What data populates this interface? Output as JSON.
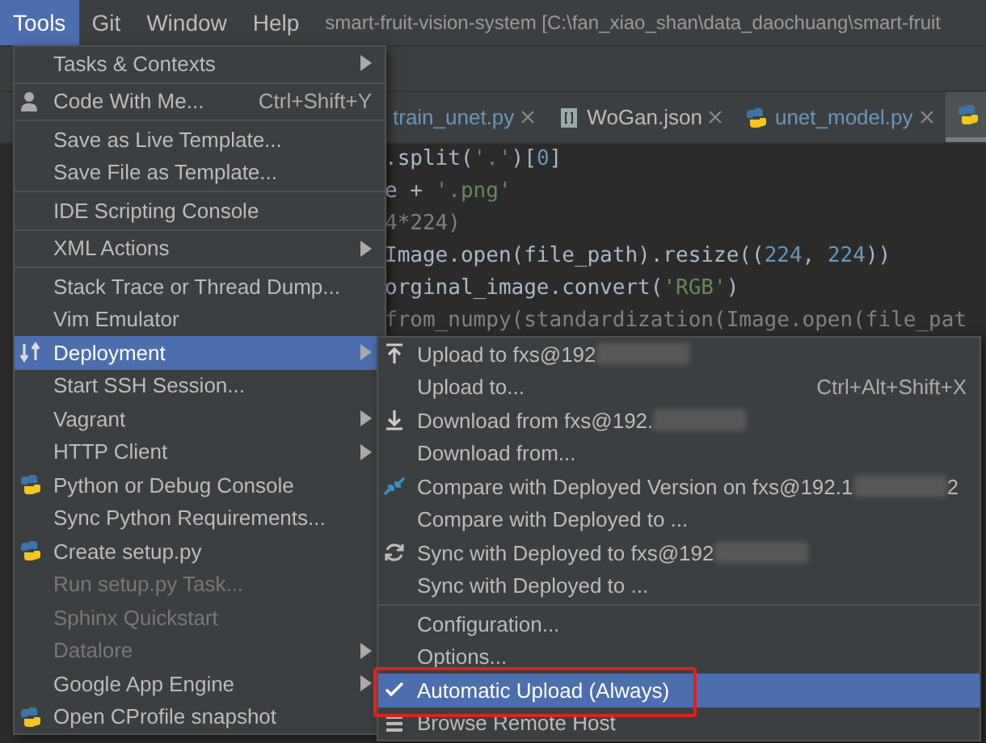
{
  "menu_bar": {
    "items": [
      {
        "label": "Tools",
        "selected": true
      },
      {
        "label": "Git",
        "selected": false
      },
      {
        "label": "Window",
        "selected": false
      },
      {
        "label": "Help",
        "selected": false
      }
    ],
    "title": "smart-fruit-vision-system [C:\\fan_xiao_shan\\data_daochuang\\smart-fruit"
  },
  "editor_tabs": [
    {
      "label": "train_unet.py",
      "modified": true,
      "selected": false
    },
    {
      "label": "WoGan.json",
      "modified": false,
      "selected": false
    },
    {
      "label": "unet_model.py",
      "modified": true,
      "selected": false
    },
    {
      "selected": true
    }
  ],
  "code_lines": [
    [
      {
        "text": ".split(",
        "kind": "plain"
      },
      {
        "text": "'.'",
        "kind": "string"
      },
      {
        "text": ")[",
        "kind": "plain"
      },
      {
        "text": "0",
        "kind": "number"
      },
      {
        "text": "]",
        "kind": "plain"
      }
    ],
    [
      {
        "text": "e + ",
        "kind": "plain"
      },
      {
        "text": "'.png'",
        "kind": "string"
      }
    ],
    [
      {
        "text": "4*224)",
        "kind": "comment"
      }
    ],
    [
      {
        "text": "Image.open(file_path).resize((",
        "kind": "plain"
      },
      {
        "text": "224",
        "kind": "number"
      },
      {
        "text": ", ",
        "kind": "plain"
      },
      {
        "text": "224",
        "kind": "number"
      },
      {
        "text": "))",
        "kind": "plain"
      }
    ],
    [
      {
        "text": "orginal_image.convert(",
        "kind": "plain"
      },
      {
        "text": "'RGB'",
        "kind": "string"
      },
      {
        "text": ")",
        "kind": "plain"
      }
    ],
    [
      {
        "text": "from_numpy(standardization(Image.open(file_pat",
        "kind": "comment"
      }
    ]
  ],
  "tools_menu": [
    {
      "label": "Tasks & Contexts",
      "submenu": true,
      "disabled": false,
      "selected": false,
      "separator_after": true
    },
    {
      "label": "Code With Me...",
      "shortcut": "Ctrl+Shift+Y",
      "disabled": false,
      "selected": false,
      "separator_after": true
    },
    {
      "label": "Save as Live Template...",
      "disabled": false,
      "selected": false
    },
    {
      "label": "Save File as Template...",
      "disabled": false,
      "selected": false,
      "separator_after": true
    },
    {
      "label": "IDE Scripting Console",
      "disabled": false,
      "selected": false,
      "separator_after": true
    },
    {
      "label": "XML Actions",
      "submenu": true,
      "disabled": false,
      "selected": false,
      "separator_after": true
    },
    {
      "label": "Stack Trace or Thread Dump...",
      "disabled": false,
      "selected": false
    },
    {
      "label": "Vim Emulator",
      "disabled": false,
      "selected": false
    },
    {
      "label": "Deployment",
      "submenu": true,
      "disabled": false,
      "selected": true
    },
    {
      "label": "Start SSH Session...",
      "disabled": false,
      "selected": false
    },
    {
      "label": "Vagrant",
      "submenu": true,
      "disabled": false,
      "selected": false
    },
    {
      "label": "HTTP Client",
      "submenu": true,
      "disabled": false,
      "selected": false
    },
    {
      "label": "Python or Debug Console",
      "disabled": false,
      "selected": false
    },
    {
      "label": "Sync Python Requirements...",
      "disabled": false,
      "selected": false
    },
    {
      "label": "Create setup.py",
      "disabled": false,
      "selected": false
    },
    {
      "label": "Run setup.py Task...",
      "disabled": true,
      "selected": false
    },
    {
      "label": "Sphinx Quickstart",
      "disabled": true,
      "selected": false
    },
    {
      "label": "Datalore",
      "submenu": true,
      "disabled": true,
      "selected": false
    },
    {
      "label": "Google App Engine",
      "submenu": true,
      "disabled": false,
      "selected": false
    },
    {
      "label": "Open CProfile snapshot",
      "disabled": false,
      "selected": false
    }
  ],
  "deployment_menu": [
    {
      "label": "Upload to fxs@192",
      "redacted": true,
      "checked": false,
      "selected": false
    },
    {
      "label": "Upload to...",
      "shortcut": "Ctrl+Alt+Shift+X",
      "checked": false,
      "selected": false
    },
    {
      "label": "Download from fxs@192.",
      "redacted": true,
      "checked": false,
      "selected": false
    },
    {
      "label": "Download from...",
      "checked": false,
      "selected": false
    },
    {
      "label": "Compare with Deployed Version on fxs@192.1",
      "redacted": true,
      "suffix": "2",
      "checked": false,
      "selected": false
    },
    {
      "label": "Compare with Deployed to ...",
      "checked": false,
      "selected": false
    },
    {
      "label": "Sync with Deployed to fxs@192",
      "redacted": true,
      "checked": false,
      "selected": false
    },
    {
      "label": "Sync with Deployed to ...",
      "checked": false,
      "selected": false,
      "separator_after": true
    },
    {
      "label": "Configuration...",
      "checked": false,
      "selected": false
    },
    {
      "label": "Options...",
      "checked": false,
      "selected": false
    },
    {
      "label": "Automatic Upload (Always)",
      "checked": true,
      "selected": true,
      "highlighted": true
    },
    {
      "label": "Browse Remote Host",
      "checked": false,
      "selected": false
    }
  ]
}
